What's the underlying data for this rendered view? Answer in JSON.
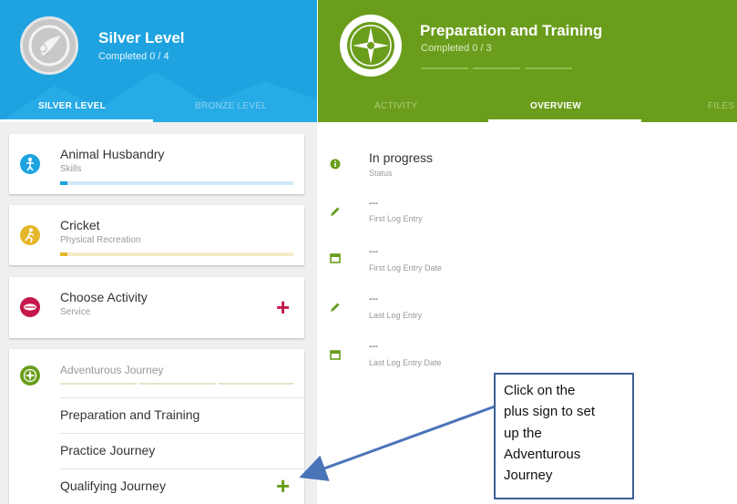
{
  "left_header": {
    "title": "Silver Level",
    "subtitle": "Completed 0 / 4",
    "tabs": [
      "SILVER LEVEL",
      "BRONZE LEVEL"
    ]
  },
  "right_header": {
    "title": "Preparation and Training",
    "subtitle": "Completed 0 / 3",
    "tabs": [
      "ACTIVITY",
      "OVERVIEW",
      "FILES"
    ]
  },
  "activities": [
    {
      "title": "Animal Husbandry",
      "subtitle": "Skills",
      "icon": "person-icon",
      "color": "#1ea3e0",
      "progress": 0.03
    },
    {
      "title": "Cricket",
      "subtitle": "Physical Recreation",
      "icon": "runner-icon",
      "color": "#e5b62a",
      "progress": 0.03
    },
    {
      "title": "Choose Activity",
      "subtitle": "Service",
      "icon": "lips-icon",
      "color": "#c4174b",
      "add_symbol": "+"
    },
    {
      "title": "Adventurous Journey",
      "icon": "compass-icon",
      "color": "#6a9d1b",
      "items": [
        "Preparation and Training",
        "Practice Journey",
        "Qualifying Journey"
      ],
      "add_symbol": "+"
    }
  ],
  "overview": [
    {
      "value": "In progress",
      "label": "Status",
      "icon": "info-icon"
    },
    {
      "value": "---",
      "label": "First Log Entry",
      "icon": "pencil-icon"
    },
    {
      "value": "---",
      "label": "First Log Entry Date",
      "icon": "calendar-icon"
    },
    {
      "value": "---",
      "label": "Last Log Entry",
      "icon": "pencil-icon"
    },
    {
      "value": "---",
      "label": "Last Log Entry Date",
      "icon": "calendar-icon"
    }
  ],
  "callout": {
    "lines": [
      "Click on the",
      "plus sign to set",
      "up the",
      "Adventurous",
      "Journey"
    ]
  },
  "colors": {
    "silver_blue": "#1ea3e0",
    "activity_green": "#6a9d1b",
    "service_red": "#c4174b",
    "cricket_yellow": "#e5b62a"
  }
}
